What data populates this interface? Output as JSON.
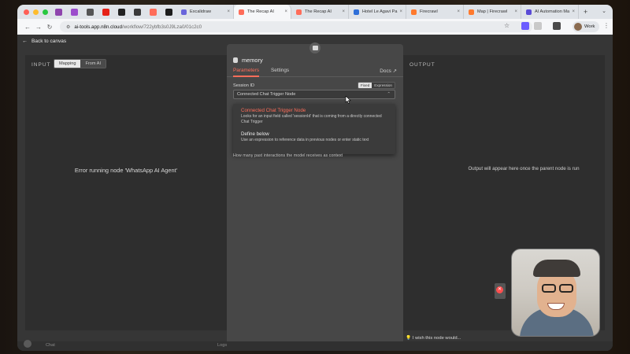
{
  "browser": {
    "tabs": [
      {
        "label": "Excalidraw",
        "fav": "#6965db"
      },
      {
        "label": "The Recap AI",
        "fav": "#ff6d5a",
        "active": true
      },
      {
        "label": "The Recap AI",
        "fav": "#ff6d5a"
      },
      {
        "label": "Hotel Le Agavi Pa",
        "fav": "#2f6fd8"
      },
      {
        "label": "Firecrawl",
        "fav": "#ff7a2e"
      },
      {
        "label": "Map | Firecrawl",
        "fav": "#ff7a2e"
      },
      {
        "label": "AI Automation Ma",
        "fav": "#5a4bd6"
      }
    ],
    "url_host": "ai-tools.app.n8n.cloud",
    "url_path": "/workflow/722ybfb3s0J9Lza0/01c2c0",
    "profile": "Work"
  },
  "app": {
    "back_label": "Back to canvas",
    "input": {
      "title": "INPUT",
      "mode_mapping": "Mapping",
      "mode_fromai": "From AI",
      "error": "Error running node 'WhatsApp AI Agent'"
    },
    "output": {
      "title": "OUTPUT",
      "message": "Output will appear here once the parent node is run"
    },
    "node": {
      "title": "memory",
      "tab_parameters": "Parameters",
      "tab_settings": "Settings",
      "docs": "Docs",
      "session_label": "Session ID",
      "info_glyph": "i",
      "fixed": "Fixed",
      "expression": "Expression",
      "select_value": "Connected Chat Trigger Node",
      "options": [
        {
          "title": "Connected Chat Trigger Node",
          "desc": "Looks for an input field called 'sessionId' that is coming from a directly connected Chat Trigger"
        },
        {
          "title": "Define below",
          "desc": "Use an expression to reference data in previous nodes or enter static text"
        }
      ],
      "hint": "How many past interactions the model receives as context"
    },
    "feedback": "I wish this node would...",
    "bottom_chat": "Chat",
    "bottom_logs": "Logs"
  }
}
